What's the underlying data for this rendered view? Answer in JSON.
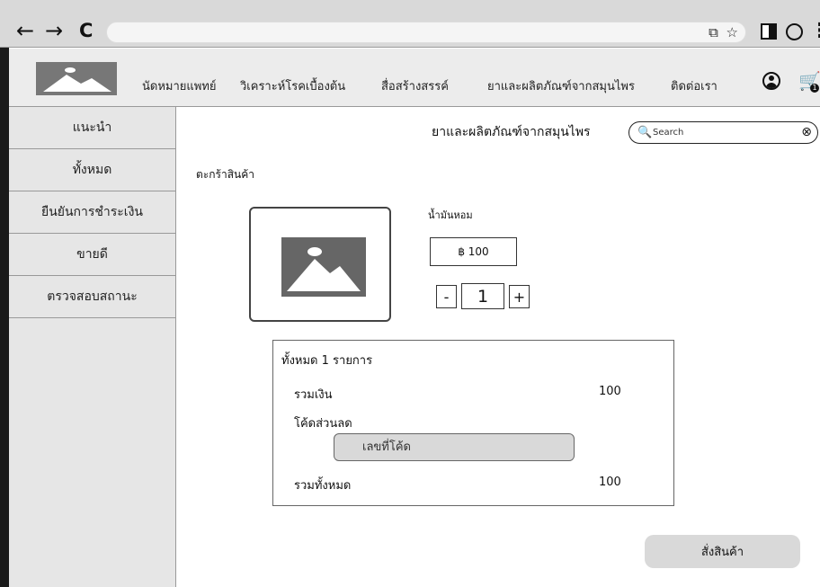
{
  "browser": {
    "back_glyph": "←",
    "forward_glyph": "→",
    "reload_glyph": "C",
    "url_icons": "⧉ ☆",
    "menu_glyph": "⋮"
  },
  "header": {
    "nav": [
      {
        "label": "นัดหมายแพทย์"
      },
      {
        "label": "วิเคราะห์โรคเบื้องต้น"
      },
      {
        "label": "สื่อสร้างสรรค์"
      },
      {
        "label": "ยาและผลิตภัณฑ์จากสมุนไพร"
      },
      {
        "label": "ติดต่อเรา"
      }
    ],
    "cart_glyph": "🛒",
    "cart_badge": "1"
  },
  "sidebar": {
    "items": [
      {
        "label": "แนะนำ"
      },
      {
        "label": "ทั้งหมด"
      },
      {
        "label": "ยืนยันการชำระเงิน"
      },
      {
        "label": "ขายดี"
      },
      {
        "label": "ตรวจสอบสถานะ"
      }
    ]
  },
  "main": {
    "title": "ยาและผลิตภัณฑ์จากสมุนไพร",
    "search": {
      "placeholder": "Search",
      "icon_glyph": "🔍",
      "clear_glyph": "⊗"
    },
    "cart_title": "ตะกร้าสินค้า",
    "product": {
      "name": "น้ำมันหอม",
      "price": "฿ 100",
      "minus": "-",
      "quantity": "1",
      "plus": "+"
    },
    "summary": {
      "count_label": "ทั้งหมด 1 รายการ",
      "subtotal_label": "รวมเงิน",
      "subtotal_value": "100",
      "discount_label": "โค้ดส่วนลด",
      "code_placeholder": "เลขที่โค้ด",
      "total_label": "รวมทั้งหมด",
      "total_value": "100"
    },
    "order_button": "สั่งสินค้า"
  },
  "colors": {
    "chrome": "#d9d9d9",
    "header": "#ececec",
    "sidebar": "#e6e6e6",
    "button": "#d9d9d9",
    "placeholder_image": "#666666"
  }
}
